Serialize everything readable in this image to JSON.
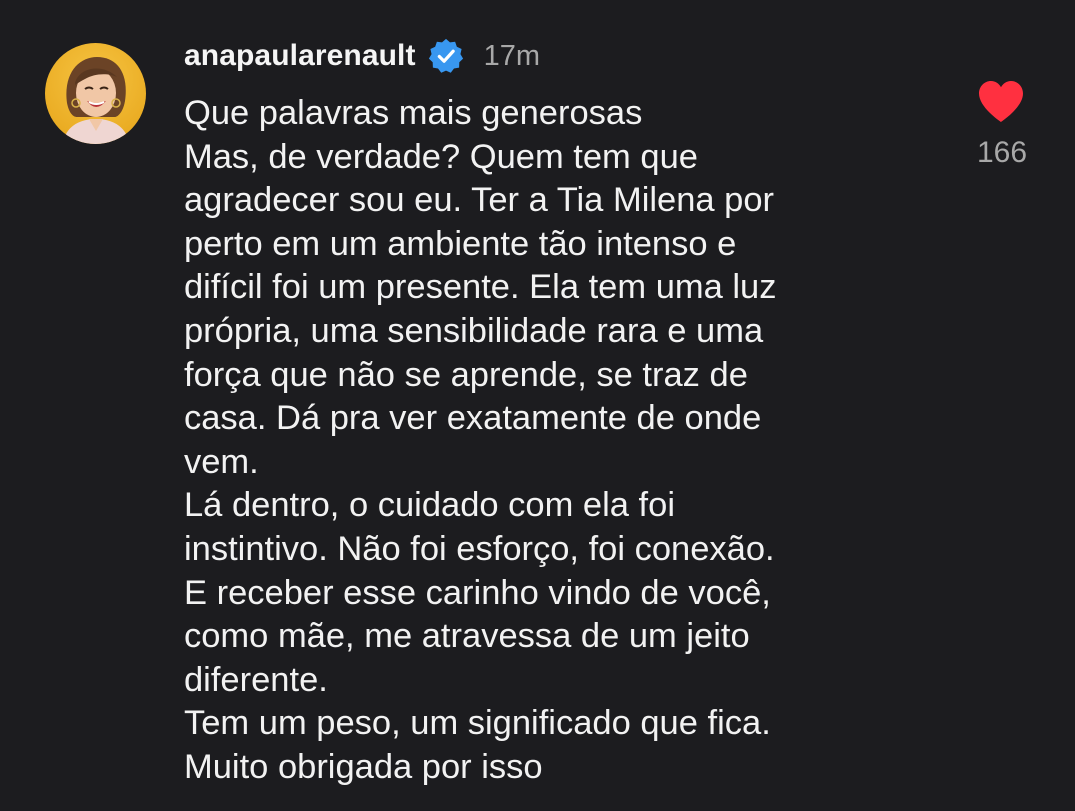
{
  "comment": {
    "username": "anapaularenault",
    "time_ago": "17m",
    "verified_icon": "verified-badge-icon",
    "text_lines": [
      "Que palavras mais generosas",
      "Mas, de verdade? Quem tem que",
      "agradecer sou eu. Ter a Tia Milena por",
      "perto em um ambiente tão intenso e",
      "difícil foi um presente. Ela tem uma luz",
      "própria, uma sensibilidade rara e uma",
      "força que não se aprende, se traz de",
      "casa. Dá pra ver exatamente de onde",
      "vem.",
      "Lá dentro, o cuidado com ela foi",
      "instintivo. Não foi esforço, foi conexão.",
      "E receber esse carinho vindo de você,",
      "como mãe, me atravessa de um jeito",
      "diferente.",
      "Tem um peso, um significado que fica.",
      "Muito obrigada por isso"
    ]
  },
  "like": {
    "icon": "heart-icon",
    "liked": true,
    "count": "166"
  },
  "colors": {
    "background": "#1c1c1f",
    "text": "#f2f2f2",
    "muted": "#a8a8a8",
    "verified": "#3897f0",
    "heart": "#ff3040"
  }
}
